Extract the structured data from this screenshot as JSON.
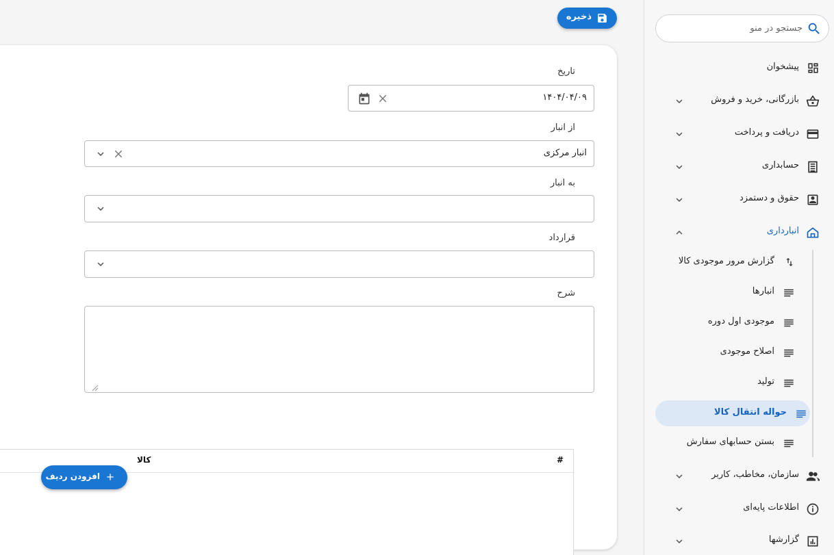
{
  "header": {
    "save_label": "ذخیره"
  },
  "form": {
    "date": {
      "label": "تاریخ",
      "value": "۱۴۰۴/۰۴/۰۹"
    },
    "from_warehouse": {
      "label": "از انبار",
      "value": "انبار مرکزی"
    },
    "to_warehouse": {
      "label": "به انبار",
      "value": ""
    },
    "contract": {
      "label": "قرارداد",
      "value": ""
    },
    "description": {
      "label": "شرح",
      "value": ""
    }
  },
  "table": {
    "columns": [
      "#",
      "کالا"
    ],
    "add_row_label": "افزودن ردیف"
  },
  "sidebar": {
    "search": {
      "placeholder": "جستجو در منو"
    },
    "items": [
      {
        "label": "پیشخوان",
        "icon": "dashboard-icon"
      },
      {
        "label": "بازرگانی، خرید و فروش",
        "icon": "basket-icon"
      },
      {
        "label": "دریافت و پرداخت",
        "icon": "credit-card-icon"
      },
      {
        "label": "حسابداری",
        "icon": "ledger-icon"
      },
      {
        "label": "حقوق و دستمزد",
        "icon": "contact-card-icon"
      },
      {
        "label": "انبارداری",
        "icon": "warehouse-icon"
      },
      {
        "label": "سازمان، مخاطب، کاربر",
        "icon": "people-icon"
      },
      {
        "label": "اطلاعات پایه‌ای",
        "icon": "info-icon"
      },
      {
        "label": "گزارشها",
        "icon": "report-chart-icon"
      }
    ],
    "warehouse_sub": [
      {
        "label": "گزارش مرور موجودی کالا",
        "icon": "swap-vert-icon"
      },
      {
        "label": "انبارها",
        "icon": "list-icon"
      },
      {
        "label": "موجودی اول دوره",
        "icon": "list-icon"
      },
      {
        "label": "اصلاح موجودی",
        "icon": "list-icon"
      },
      {
        "label": "تولید",
        "icon": "list-icon"
      },
      {
        "label": "حواله انتقال کالا",
        "icon": "list-icon"
      },
      {
        "label": "بستن حسابهای سفارش",
        "icon": "list-icon"
      }
    ]
  },
  "colors": {
    "accent": "#1976d2",
    "active_bg": "#dce8f5",
    "active_text": "#1565c0"
  }
}
